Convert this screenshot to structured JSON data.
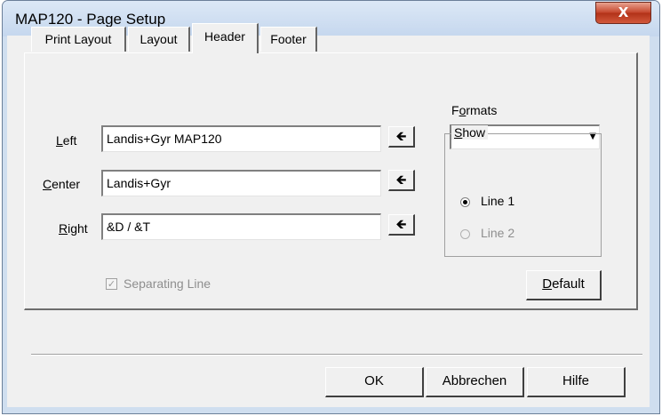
{
  "window": {
    "title": "MAP120 - Page Setup",
    "close_symbol": "X"
  },
  "tabs": [
    {
      "label": "Print Layout"
    },
    {
      "label": "Layout"
    },
    {
      "label": "Header"
    },
    {
      "label": "Footer"
    }
  ],
  "header_tab": {
    "left": {
      "label_u": "L",
      "label_rest": "eft",
      "value": "Landis+Gyr MAP120"
    },
    "center": {
      "label_u": "C",
      "label_rest": "enter",
      "value": "Landis+Gyr"
    },
    "right": {
      "label_u": "R",
      "label_rest": "ight",
      "value": "&D / &T"
    },
    "insert_arrow_symbol": "🡸",
    "formats": {
      "label_pre": "F",
      "label_u": "o",
      "label_post": "rmats",
      "selected": ""
    },
    "show": {
      "legend_u": "S",
      "legend_rest": "how",
      "line1": "Line 1",
      "line2": "Line 2",
      "selected": "Line 1"
    },
    "separating_line": {
      "label": "Separating Line",
      "checked": true,
      "enabled": false
    },
    "default_button": {
      "label_u": "D",
      "label_rest": "efault"
    }
  },
  "buttons": {
    "ok": "OK",
    "cancel": "Abbrechen",
    "help": "Hilfe"
  }
}
